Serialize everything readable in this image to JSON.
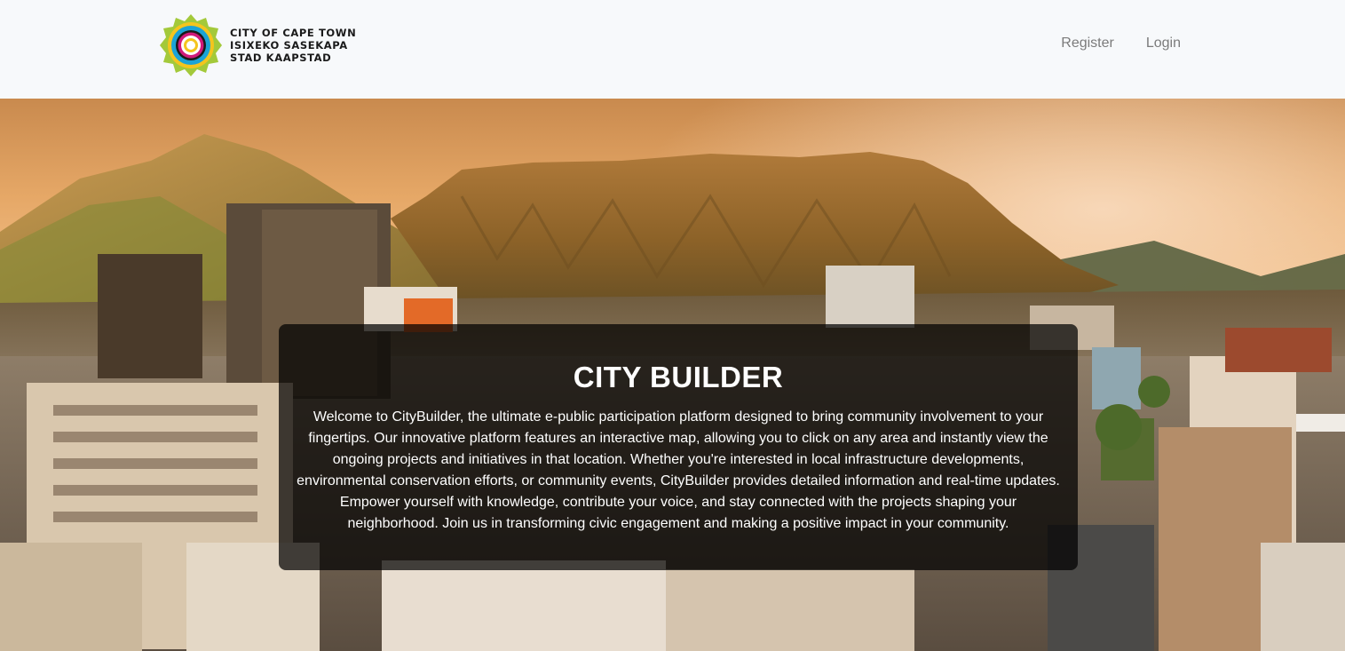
{
  "header": {
    "logo_icon": "city-of-cape-town-emblem",
    "brand_lines": [
      "CITY OF CAPE TOWN",
      "ISIXEKO SASEKAPA",
      "STAD KAAPSTAD"
    ],
    "nav": {
      "register": "Register",
      "login": "Login"
    }
  },
  "hero": {
    "background": "cape-town-cityscape-table-mountain-sunset",
    "title": "CITY BUILDER",
    "description": "Welcome to CityBuilder, the ultimate e-public participation platform designed to bring community involvement to your fingertips. Our innovative platform features an interactive map, allowing you to click on any area and instantly view the ongoing projects and initiatives in that location. Whether you're interested in local infrastructure developments, environmental conservation efforts, or community events, CityBuilder provides detailed information and real-time updates. Empower yourself with knowledge, contribute your voice, and stay connected with the projects shaping your neighborhood. Join us in transforming civic engagement and making a positive impact in your community."
  },
  "colors": {
    "navbar_bg": "#f7f9fb",
    "nav_link": "#7b7b7b",
    "overlay": "rgba(0,0,0,0.72)",
    "logo_green": "#a3c93a",
    "logo_blue": "#1ba3d6",
    "logo_magenta": "#d1197a",
    "logo_yellow": "#f4c51e"
  }
}
